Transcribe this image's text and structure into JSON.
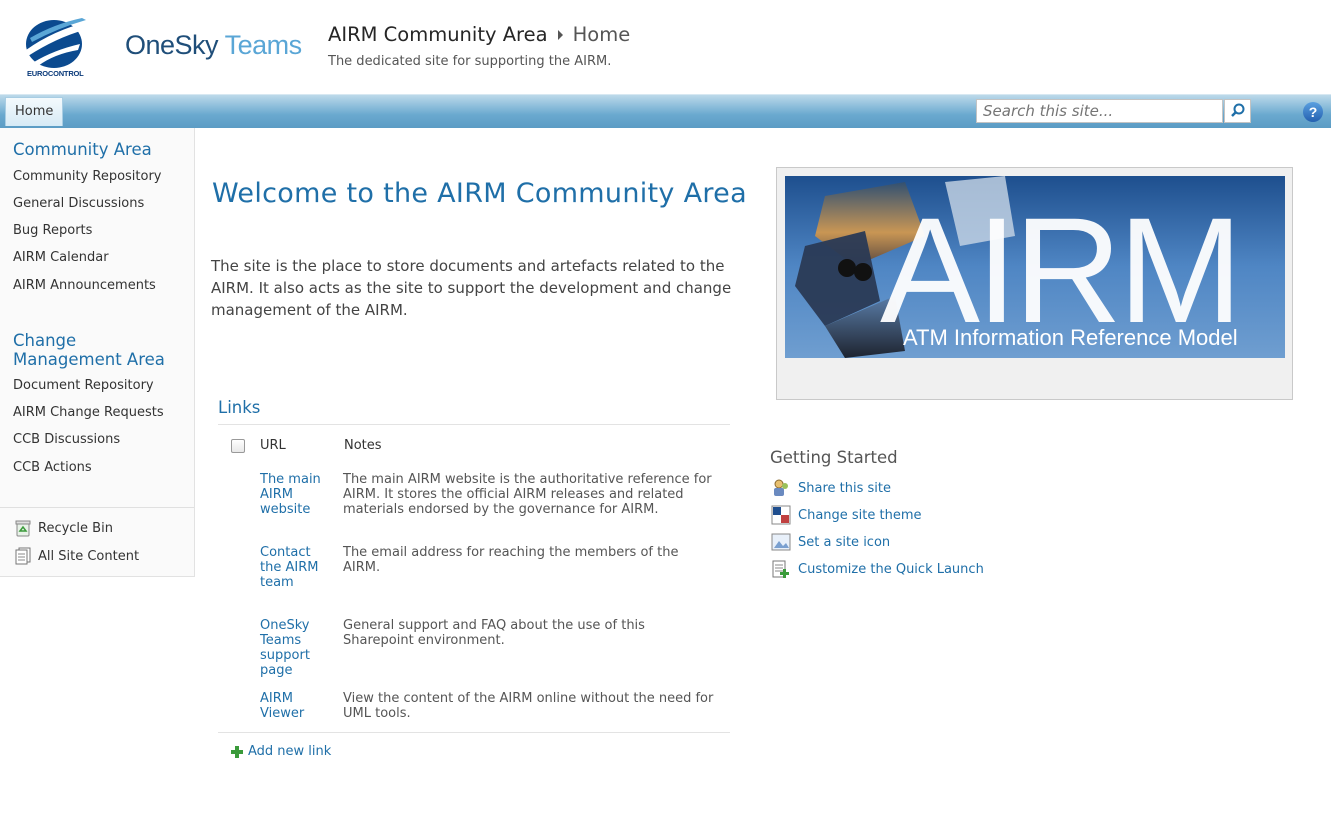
{
  "header": {
    "logo_text": "EUROCONTROL",
    "brand_part1": "OneSky",
    "brand_part2": "Teams",
    "site_title": "AIRM Community Area",
    "breadcrumb_current": "Home",
    "site_description": "The dedicated site for supporting the AIRM."
  },
  "topnav": {
    "home_tab": "Home",
    "search_placeholder": "Search this site...",
    "help_label": "?"
  },
  "sidebar": {
    "section1_heading": "Community Area",
    "section1_items": [
      "Community Repository",
      "General Discussions",
      "Bug Reports",
      "AIRM Calendar",
      "AIRM Announcements"
    ],
    "section2_heading": "Change Management Area",
    "section2_items": [
      "Document Repository",
      "AIRM Change Requests",
      "CCB Discussions",
      "CCB Actions"
    ],
    "recycle_bin": "Recycle Bin",
    "all_site_content": "All Site Content"
  },
  "main": {
    "welcome": "Welcome to the AIRM Community Area",
    "intro": "The site is the place to store documents and artefacts related to the AIRM. It also acts as the site to support the development and change management of the AIRM."
  },
  "links": {
    "title": "Links",
    "col_url": "URL",
    "col_notes": "Notes",
    "rows": [
      {
        "url": "The main AIRM website",
        "notes": "The main AIRM website is the authoritative reference for AIRM. It stores the official AIRM releases and related materials endorsed by the governance for AIRM."
      },
      {
        "url": "Contact the AIRM team",
        "notes": "The email address for reaching the members of the AIRM."
      },
      {
        "url": "OneSky Teams support page",
        "notes": "General support and FAQ about the use of this Sharepoint environment."
      },
      {
        "url": "AIRM Viewer",
        "notes": "View the content of the AIRM online without the need for UML tools."
      }
    ],
    "add_new": "Add new link"
  },
  "banner": {
    "big_text": "AIRM",
    "subtitle": "ATM Information Reference Model"
  },
  "getting_started": {
    "title": "Getting Started",
    "items": [
      "Share this site",
      "Change site theme",
      "Set a site icon",
      "Customize the Quick Launch"
    ]
  },
  "colors": {
    "accent": "#1f6fa8",
    "nav_bar": "#6aa9cf"
  }
}
